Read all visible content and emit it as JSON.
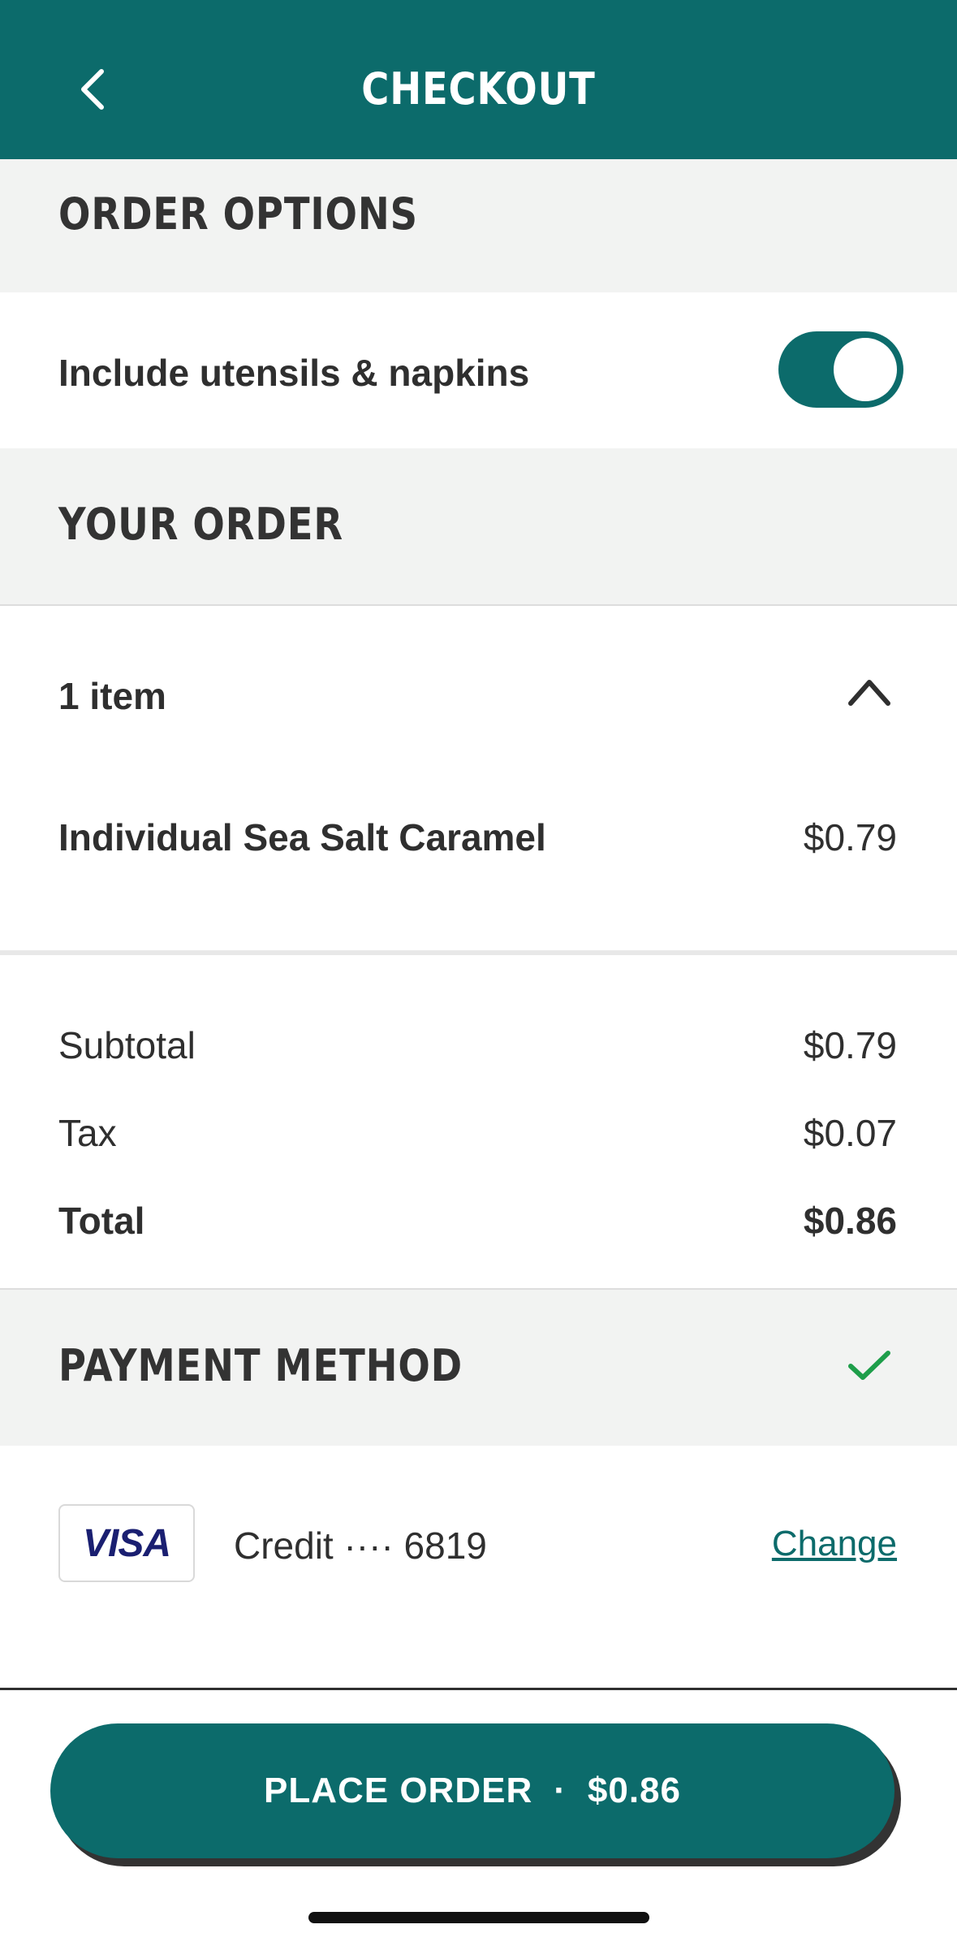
{
  "header": {
    "title": "CHECKOUT",
    "back_icon": "chevron-left-icon"
  },
  "order_options": {
    "title": "ORDER OPTIONS",
    "utensils_label": "Include utensils & napkins",
    "utensils_enabled": true
  },
  "your_order": {
    "title": "YOUR ORDER",
    "item_count_label": "1 item",
    "collapse_icon": "chevron-up-icon",
    "items": [
      {
        "name": "Individual Sea Salt Caramel",
        "price": "$0.79"
      }
    ],
    "summary": {
      "subtotal_label": "Subtotal",
      "subtotal_value": "$0.79",
      "tax_label": "Tax",
      "tax_value": "$0.07",
      "total_label": "Total",
      "total_value": "$0.86"
    }
  },
  "payment": {
    "title": "PAYMENT METHOD",
    "status_icon": "checkmark-icon",
    "card_brand": "VISA",
    "card_label": "Credit ···· 6819",
    "change_label": "Change"
  },
  "place_order": {
    "label": "PLACE ORDER",
    "separator": "·",
    "amount": "$0.86"
  },
  "colors": {
    "brand": "#0c6b6b",
    "section_bg": "#f2f3f2",
    "success": "#1e9e4a",
    "visa_blue": "#1a1f71"
  }
}
